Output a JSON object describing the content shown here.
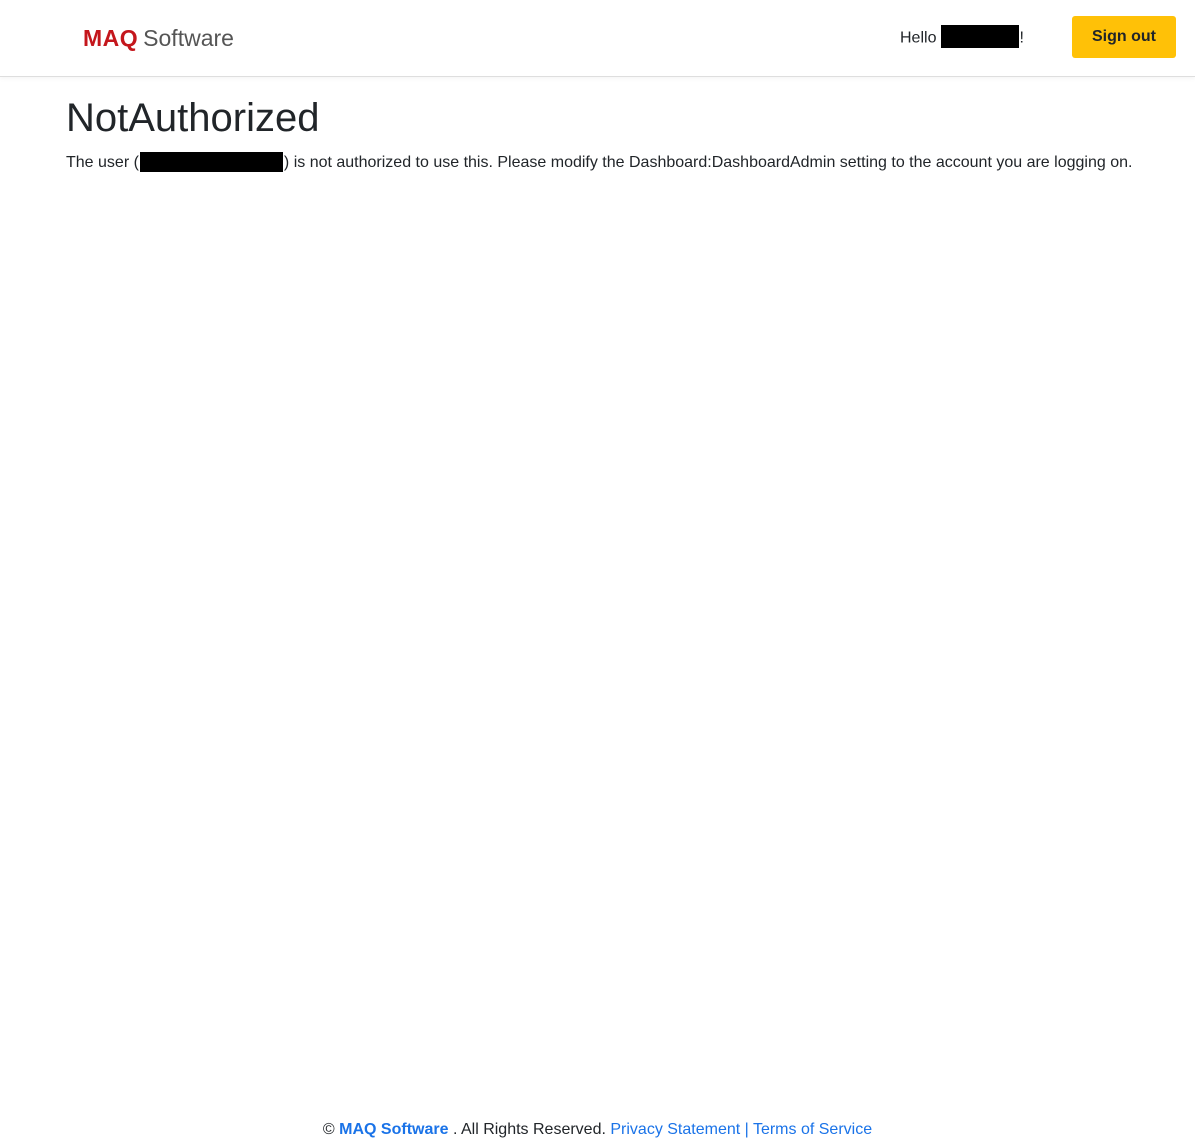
{
  "header": {
    "logo": {
      "maq": "MAQ",
      "software": "Software"
    },
    "greeting_prefix": "Hello",
    "greeting_suffix": "!",
    "signout_label": "Sign out"
  },
  "main": {
    "title": "NotAuthorized",
    "message_prefix": "The user (",
    "message_suffix": ") is not authorized to use this. Please modify the Dashboard:DashboardAdmin setting to the account you are logging on."
  },
  "footer": {
    "copyright_symbol": "©",
    "brand_link": "MAQ Software",
    "rights": ". All Rights Reserved.",
    "privacy_link": "Privacy Statement",
    "separator": "|",
    "terms_link": "Terms of Service"
  },
  "colors": {
    "brand_red": "#c4161c",
    "signout_bg": "#ffc107",
    "link_blue": "#1a73e8"
  }
}
